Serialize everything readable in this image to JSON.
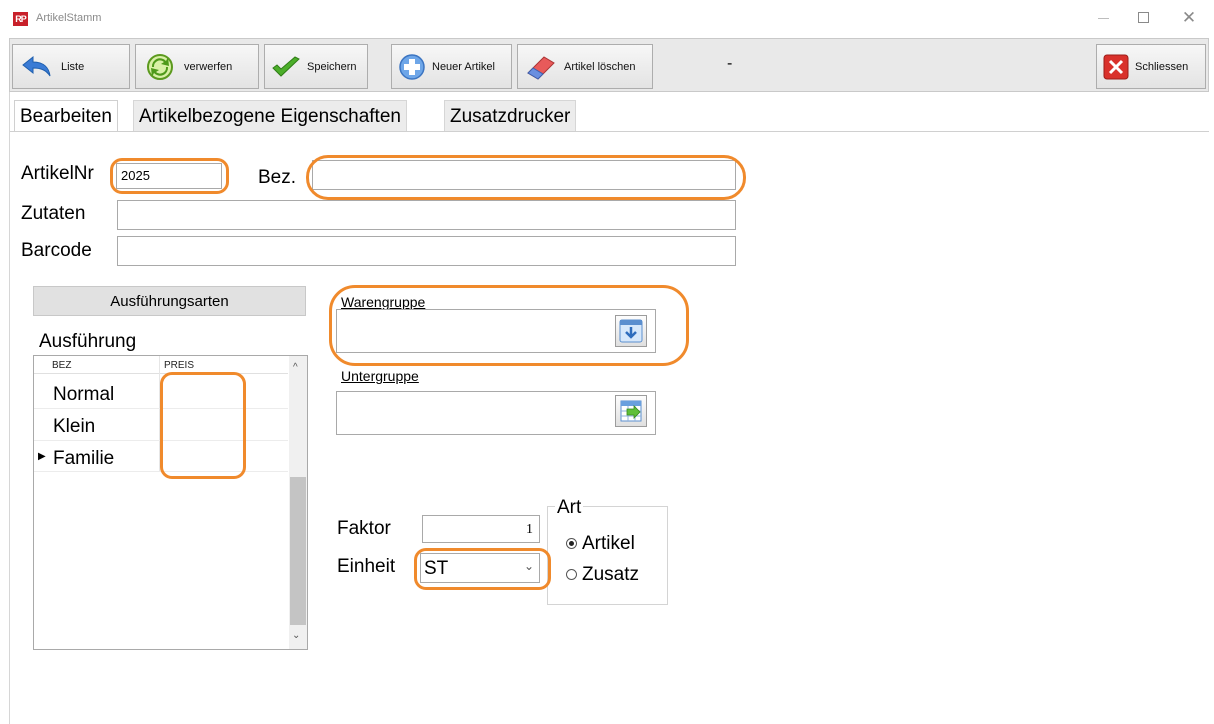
{
  "window": {
    "title": "ArtikelStamm",
    "logo": "RP"
  },
  "toolbar": {
    "liste": "Liste",
    "verwerfen": "verwerfen",
    "speichern": "Speichern",
    "neuer_artikel": "Neuer Artikel",
    "artikel_loeschen": "Artikel löschen",
    "status": "-",
    "schliessen": "Schliessen"
  },
  "tabs": [
    "Bearbeiten",
    "Artikelbezogene Eigenschaften",
    "Zusatzdrucker"
  ],
  "form": {
    "artikelnr_label": "ArtikelNr",
    "artikelnr_value": "2025",
    "bez_label": "Bez.",
    "bez_value": "",
    "zutaten_label": "Zutaten",
    "zutaten_value": "",
    "barcode_label": "Barcode",
    "barcode_value": ""
  },
  "ausfuehrung": {
    "button": "Ausführungsarten",
    "group_label": "Ausführung",
    "columns": [
      "BEZ",
      "PREIS"
    ],
    "rows": [
      {
        "bez": "Normal",
        "preis": ""
      },
      {
        "bez": "Klein",
        "preis": ""
      },
      {
        "bez": "Familie",
        "preis": ""
      }
    ],
    "current_row_marker": "▶"
  },
  "warengruppe": {
    "label": "Warengruppe",
    "value": ""
  },
  "untergruppe": {
    "label": "Untergruppe",
    "value": ""
  },
  "faktor": {
    "label": "Faktor",
    "value": "1"
  },
  "einheit": {
    "label": "Einheit",
    "value": "ST"
  },
  "art": {
    "label": "Art",
    "options": [
      "Artikel",
      "Zusatz"
    ],
    "selected": "Artikel"
  },
  "colors": {
    "highlight": "#f08a2c",
    "close_red": "#d9312b"
  },
  "icons": {
    "liste": "arrow-back-icon",
    "verwerfen": "refresh-icon",
    "speichern": "checkmark-icon",
    "neuer_artikel": "plus-icon",
    "artikel_loeschen": "eraser-icon",
    "schliessen": "close-x-icon"
  }
}
